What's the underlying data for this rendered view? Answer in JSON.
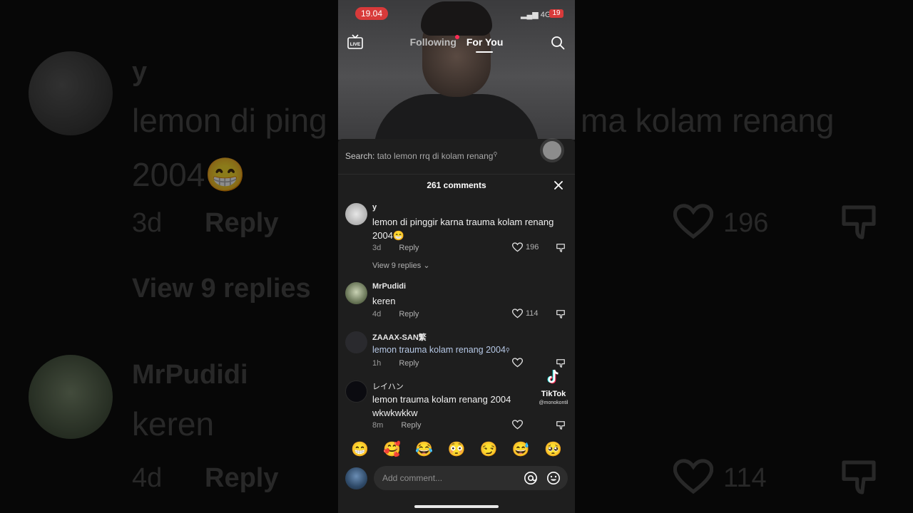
{
  "status_bar": {
    "time": "19.04",
    "network": "4G",
    "battery": "19"
  },
  "top_nav": {
    "following_label": "Following",
    "for_you_label": "For You",
    "live_label": "LIVE"
  },
  "search_suggestion": {
    "prefix": "Search:",
    "query": "tato lemon rrq di kolam renang"
  },
  "comments_sheet": {
    "count_label": "261 comments",
    "comments": [
      {
        "name": "y",
        "text": "lemon di pinggir karna trauma kolam renang 2004😁",
        "age": "3d",
        "reply_label": "Reply",
        "likes": "196",
        "view_replies": "View 9 replies"
      },
      {
        "name": "MrPudidi",
        "text": "keren",
        "age": "4d",
        "reply_label": "Reply",
        "likes": "114"
      },
      {
        "name": "ZAAAX-SAN繁",
        "text": "lemon trauma kolam renang 2004",
        "age": "1h",
        "reply_label": "Reply",
        "likes": ""
      },
      {
        "name": "レイハン",
        "text": "lemon trauma kolam renang 2004 wkwkwkkw",
        "age": "8m",
        "reply_label": "Reply",
        "likes": ""
      }
    ]
  },
  "watermark": {
    "brand": "TikTok",
    "handle": "@monokontil"
  },
  "emoji_bar": [
    "😁",
    "🥰",
    "😂",
    "😳",
    "😏",
    "😅",
    "🥺"
  ],
  "composer": {
    "placeholder": "Add comment..."
  },
  "background_zoom": {
    "name_1": "y",
    "text_1a": "lemon di ping",
    "text_1b": "ma kolam renang",
    "text_1c": "2004😁",
    "age_1": "3d",
    "reply_1": "Reply",
    "likes_1": "196",
    "view_replies": "View 9 replies",
    "name_2": "MrPudidi",
    "text_2": "keren",
    "age_2": "4d",
    "reply_2": "Reply",
    "likes_2": "114"
  },
  "colors": {
    "accent_red": "#ff2c55",
    "time_pill": "#d83a3a",
    "sheet_bg": "#1e1e1e",
    "link_text": "#b6c8e6"
  }
}
